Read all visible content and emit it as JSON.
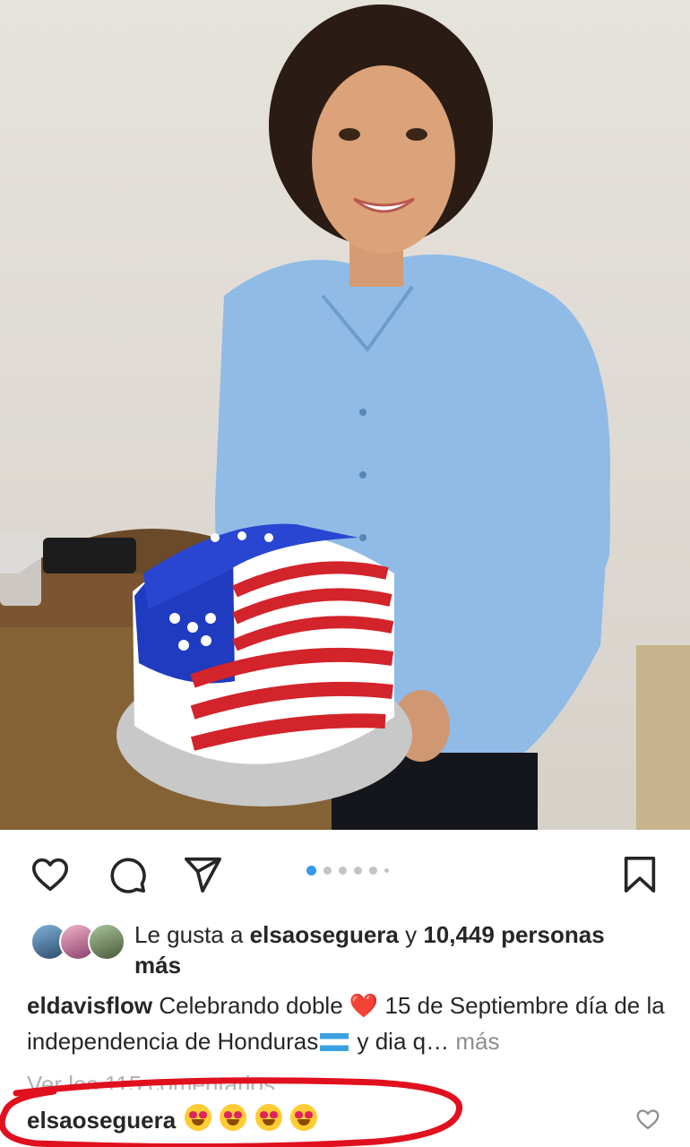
{
  "post": {
    "carousel": {
      "count": 6,
      "active_index": 0
    },
    "likes": {
      "prefix": "Le gusta a ",
      "user": "elsaoseguera",
      "joiner": " y ",
      "count": "10,449 personas",
      "suffix": "más"
    },
    "caption": {
      "username": "eldavisflow",
      "text_1": "Celebrando doble",
      "heart": "❤️",
      "text_2": "15 de Septiembre día de la independencia de Honduras",
      "text_3": "y dia q…",
      "more": "más"
    },
    "view_comments": "Ver los 115 comentarios",
    "comment": {
      "username": "elsaoseguera",
      "emojis": [
        "heart-eyes",
        "heart-eyes",
        "heart-eyes",
        "heart-eyes"
      ]
    }
  },
  "icons": {
    "like": "heart-outline-icon",
    "comment": "comment-bubble-icon",
    "share": "paper-plane-icon",
    "save": "bookmark-icon",
    "comment_like": "small-heart-icon"
  },
  "colors": {
    "text": "#262626",
    "muted": "#8e8e8e",
    "carousel_active": "#3897f0",
    "annotation": "#e0101e"
  }
}
